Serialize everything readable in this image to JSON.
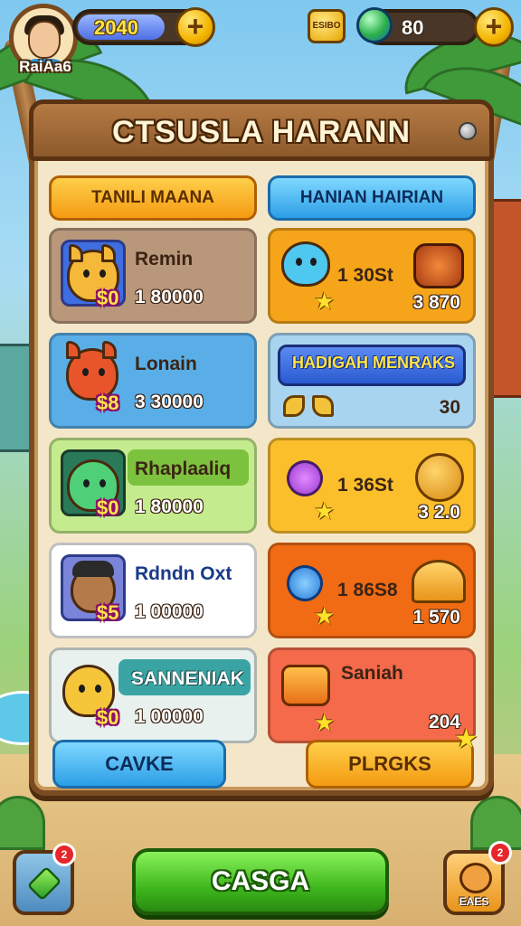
{
  "hud": {
    "player_name": "RaiAa6",
    "coins_value": "2040",
    "coin_badge_text": "ESIBO",
    "gems_value": "80",
    "plus_label": "+"
  },
  "panel": {
    "title": "CTSUSLA HARANN",
    "tabs": [
      {
        "label": "TANILI MAANA",
        "color": "#f49b12"
      },
      {
        "label": "HANIAN HAIRIAN",
        "color": "#2c9ee6"
      }
    ],
    "left_cards": [
      {
        "name": "Remin",
        "tag": "$0",
        "price": "1 80000",
        "bg": "#b9977a"
      },
      {
        "name": "Lonain",
        "tag": "$8",
        "price": "3 30000",
        "bg": "#5aaee8"
      },
      {
        "name": "Rhaplaaliq",
        "tag": "$0",
        "price": "1 80000",
        "bg": "#9ed86b"
      },
      {
        "name": "Rdndn Oxt",
        "tag": "$5",
        "price": "1 00000",
        "bg": "#ffffff"
      },
      {
        "name": "SANNENIAK",
        "tag": "$0",
        "price": "1 00000",
        "bg": "#cfe8e8"
      }
    ],
    "right_cards": [
      {
        "mid": "1 30St",
        "value": "3 870",
        "bg": "#f6a51a",
        "icon": "drum-icon"
      },
      {
        "banner": "HADIGAH MENRAKS",
        "value": "30",
        "bg": "#a9d4f0",
        "icon": "croissant-icon"
      },
      {
        "mid": "1 36St",
        "value": "3 2.0",
        "bg": "#fbbf2c",
        "icon": "ball-icon"
      },
      {
        "mid": "1 86S8",
        "value": "1 570",
        "bg": "#f06b14",
        "icon": "taco-icon"
      },
      {
        "name": "Saniah",
        "value": "204",
        "bg": "#f46a4a",
        "icon": "lantern-icon"
      }
    ],
    "buttons": {
      "cancel": "CAVKE",
      "perks": "PLRGKS"
    }
  },
  "bottom": {
    "main_button": "CASGA",
    "left_notif": "2",
    "right_notif": "2",
    "right_label": "EAES"
  }
}
